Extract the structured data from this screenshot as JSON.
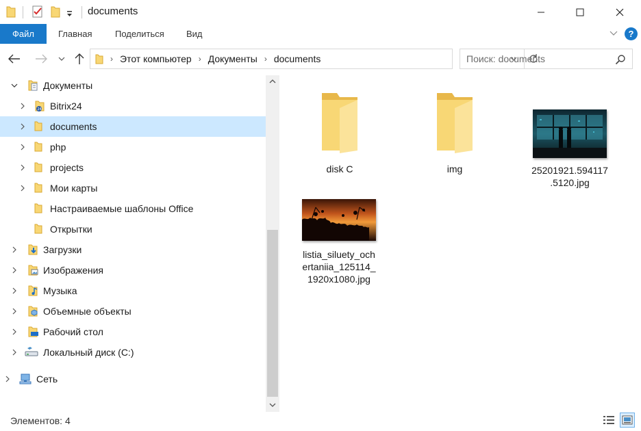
{
  "window": {
    "title": "documents",
    "minimize_glyph": "—",
    "maximize_glyph": "☐",
    "close_glyph": "✕"
  },
  "quick_access": {
    "icons": [
      "folder-icon",
      "properties-checklist-icon",
      "new-folder-icon",
      "customize-dropdown-icon"
    ]
  },
  "ribbon": {
    "file_tab": "Файл",
    "tabs": [
      "Главная",
      "Поделиться",
      "Вид"
    ],
    "help_label": "?"
  },
  "address": {
    "crumbs": [
      "Этот компьютер",
      "Документы",
      "documents"
    ]
  },
  "search": {
    "placeholder": "Поиск: documents"
  },
  "tree": {
    "items": [
      {
        "label": "Документы",
        "icon": "documents-library-icon",
        "state": "expanded"
      },
      {
        "label": "Bitrix24",
        "icon": "bitrix-folder-icon",
        "state": "collapsed"
      },
      {
        "label": "documents",
        "icon": "folder-icon",
        "state": "collapsed",
        "selected": true
      },
      {
        "label": "php",
        "icon": "folder-icon",
        "state": "collapsed"
      },
      {
        "label": "projects",
        "icon": "folder-icon",
        "state": "collapsed"
      },
      {
        "label": "Мои карты",
        "icon": "folder-icon",
        "state": "collapsed"
      },
      {
        "label": "Настраиваемые шаблоны Office",
        "icon": "folder-icon",
        "state": "none"
      },
      {
        "label": "Открытки",
        "icon": "folder-icon",
        "state": "none"
      },
      {
        "label": "Загрузки",
        "icon": "downloads-icon",
        "state": "collapsed"
      },
      {
        "label": "Изображения",
        "icon": "pictures-icon",
        "state": "collapsed"
      },
      {
        "label": "Музыка",
        "icon": "music-icon",
        "state": "collapsed"
      },
      {
        "label": "Объемные объекты",
        "icon": "3d-objects-icon",
        "state": "collapsed"
      },
      {
        "label": "Рабочий стол",
        "icon": "desktop-icon",
        "state": "collapsed"
      },
      {
        "label": "Локальный диск (C:)",
        "icon": "drive-icon",
        "state": "collapsed"
      },
      {
        "label": "Сеть",
        "icon": "network-icon",
        "state": "collapsed"
      }
    ]
  },
  "content": {
    "items": [
      {
        "name": "disk C",
        "type": "folder"
      },
      {
        "name": "img",
        "type": "folder"
      },
      {
        "name": "25201921.594117.5120.jpg",
        "type": "image",
        "line1": "25201921.594117",
        "line2": ".5120.jpg"
      },
      {
        "name": "listia_siluety_ochertaniia_125114_1920x1080.jpg",
        "type": "image",
        "line1": "listia_siluety_och",
        "line2": "ertaniia_125114_",
        "line3": "1920x1080.jpg"
      }
    ]
  },
  "status": {
    "count_text": "Элементов: 4"
  },
  "colors": {
    "accent": "#1979ca",
    "selection": "#cce8ff",
    "folder": "#f8d775"
  }
}
